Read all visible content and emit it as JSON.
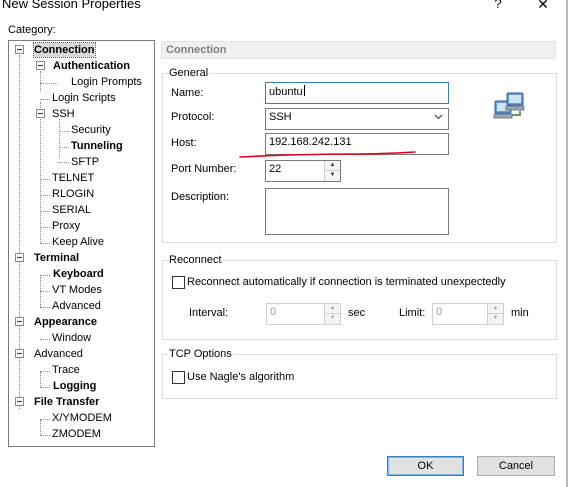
{
  "window": {
    "title": "New Session Properties",
    "help_glyph": "?",
    "close_glyph": "✕"
  },
  "category": {
    "label": "Category:",
    "tree": [
      {
        "label": "Connection",
        "bold": true,
        "selected": true
      },
      {
        "label": "Authentication",
        "bold": true
      },
      {
        "label": "Login Prompts"
      },
      {
        "label": "Login Scripts"
      },
      {
        "label": "SSH"
      },
      {
        "label": "Security"
      },
      {
        "label": "Tunneling",
        "bold": true
      },
      {
        "label": "SFTP"
      },
      {
        "label": "TELNET"
      },
      {
        "label": "RLOGIN"
      },
      {
        "label": "SERIAL"
      },
      {
        "label": "Proxy"
      },
      {
        "label": "Keep Alive"
      },
      {
        "label": "Terminal",
        "bold": true
      },
      {
        "label": "Keyboard",
        "bold": true
      },
      {
        "label": "VT Modes"
      },
      {
        "label": "Advanced"
      },
      {
        "label": "Appearance",
        "bold": true
      },
      {
        "label": "Window"
      },
      {
        "label": "Advanced"
      },
      {
        "label": "Trace"
      },
      {
        "label": "Logging",
        "bold": true
      },
      {
        "label": "File Transfer",
        "bold": true
      },
      {
        "label": "X/YMODEM"
      },
      {
        "label": "ZMODEM"
      }
    ]
  },
  "panel": {
    "header": "Connection",
    "general": {
      "title": "General",
      "name_label": "Name:",
      "name_value": "ubuntu",
      "protocol_label": "Protocol:",
      "protocol_value": "SSH",
      "host_label": "Host:",
      "host_value": "192.168.242.131",
      "port_label": "Port Number:",
      "port_value": "22",
      "description_label": "Description:",
      "description_value": ""
    },
    "reconnect": {
      "title": "Reconnect",
      "checkbox_label": "Reconnect automatically if connection is terminated unexpectedly",
      "checked": false,
      "interval_label": "Interval:",
      "interval_value": "0",
      "interval_unit": "sec",
      "limit_label": "Limit:",
      "limit_value": "0",
      "limit_unit": "min"
    },
    "tcp": {
      "title": "TCP Options",
      "nagle_label": "Use Nagle's algorithm",
      "checked": false
    }
  },
  "buttons": {
    "ok": "OK",
    "cancel": "Cancel"
  },
  "colors": {
    "accent_border": "#3c7fb1",
    "annotation_red": "#e0001b",
    "header_text": "#7f7f7f"
  },
  "icons": {
    "dialog_icon": "network-computers-icon",
    "protocol_dropdown": "chevron-down-icon"
  }
}
